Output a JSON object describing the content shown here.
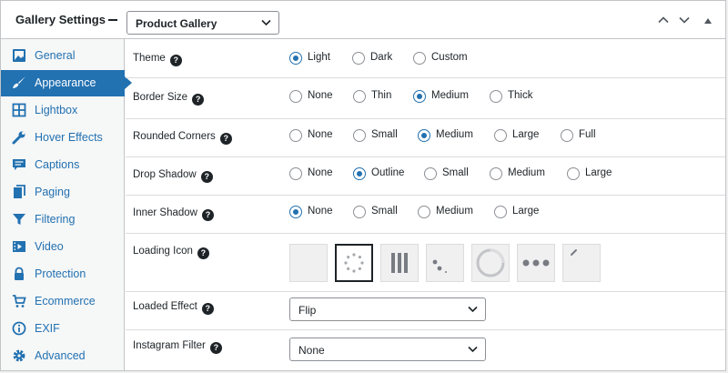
{
  "header": {
    "title": "Gallery Settings",
    "gallery_select": "Product Gallery"
  },
  "sidebar": {
    "items": [
      {
        "label": "General",
        "icon": "image-icon"
      },
      {
        "label": "Appearance",
        "icon": "brush-icon",
        "active": true
      },
      {
        "label": "Lightbox",
        "icon": "grid-icon"
      },
      {
        "label": "Hover Effects",
        "icon": "wrench-icon"
      },
      {
        "label": "Captions",
        "icon": "caption-icon"
      },
      {
        "label": "Paging",
        "icon": "pages-icon"
      },
      {
        "label": "Filtering",
        "icon": "filter-icon"
      },
      {
        "label": "Video",
        "icon": "video-icon"
      },
      {
        "label": "Protection",
        "icon": "lock-icon"
      },
      {
        "label": "Ecommerce",
        "icon": "cart-icon"
      },
      {
        "label": "EXIF",
        "icon": "info-icon"
      },
      {
        "label": "Advanced",
        "icon": "gear-icon"
      }
    ]
  },
  "settings": {
    "theme": {
      "label": "Theme",
      "options": [
        "Light",
        "Dark",
        "Custom"
      ],
      "selected": "Light"
    },
    "border_size": {
      "label": "Border Size",
      "options": [
        "None",
        "Thin",
        "Medium",
        "Thick"
      ],
      "selected": "Medium"
    },
    "rounded_corners": {
      "label": "Rounded Corners",
      "options": [
        "None",
        "Small",
        "Medium",
        "Large",
        "Full"
      ],
      "selected": "Medium"
    },
    "drop_shadow": {
      "label": "Drop Shadow",
      "options": [
        "None",
        "Outline",
        "Small",
        "Medium",
        "Large"
      ],
      "selected": "Outline"
    },
    "inner_shadow": {
      "label": "Inner Shadow",
      "options": [
        "None",
        "Small",
        "Medium",
        "Large"
      ],
      "selected": "None"
    },
    "loading_icon": {
      "label": "Loading Icon",
      "selected_index": 1
    },
    "loaded_effect": {
      "label": "Loaded Effect",
      "value": "Flip"
    },
    "instagram_filter": {
      "label": "Instagram Filter",
      "value": "None"
    }
  },
  "colors": {
    "accent": "#2271b1",
    "text": "#1d2327",
    "border": "#c3c4c7"
  }
}
